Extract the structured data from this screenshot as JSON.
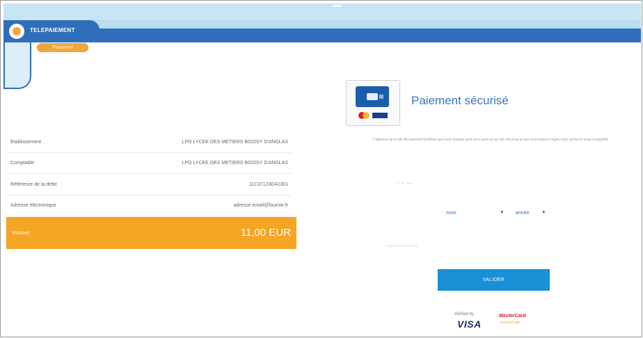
{
  "header": {
    "app_title": "TELEPAIEMENT",
    "tab_label": "Paiement"
  },
  "summary": {
    "rows": [
      {
        "label": "Etablissement",
        "value": "LPO LYCEE DES METIERS BOISSY D'ANGLAS"
      },
      {
        "label": "Comptable",
        "value": "LPO LYCEE DES METIERS BOISSY D'ANGLAS"
      },
      {
        "label": "Référence de la dette",
        "value": "11C37123D42301"
      },
      {
        "label": "Adresse électronique",
        "value": "adresse email@fournie.fr"
      }
    ],
    "amount_label": "Montant",
    "amount_value": "11,00 EUR"
  },
  "payment": {
    "title": "Paiement sécurisé",
    "notice": "L'adresse de la site de paiement préférée par votre banque pour vous avez su un site sécurisé et que vous pouvez régler votre achat en toute tranquillité",
    "card_number_placeholder": "N° de carte",
    "month_value": "mois",
    "year_value": "année",
    "cvv_placeholder": "Cryptogramme visuel",
    "validate_label": "VALIDER"
  },
  "badges": {
    "verified_by": "Verified by",
    "visa": "VISA",
    "mastercard": "MasterCard",
    "securecode": "SecureCode"
  },
  "colors": {
    "header_blue": "#2f6fba",
    "accent_orange": "#f5a524",
    "button_blue": "#1a90d6"
  },
  "icons": {
    "logo": "telepaiement-logo-icon",
    "card": "cb-card-icon",
    "caret": "caret-down-icon"
  }
}
